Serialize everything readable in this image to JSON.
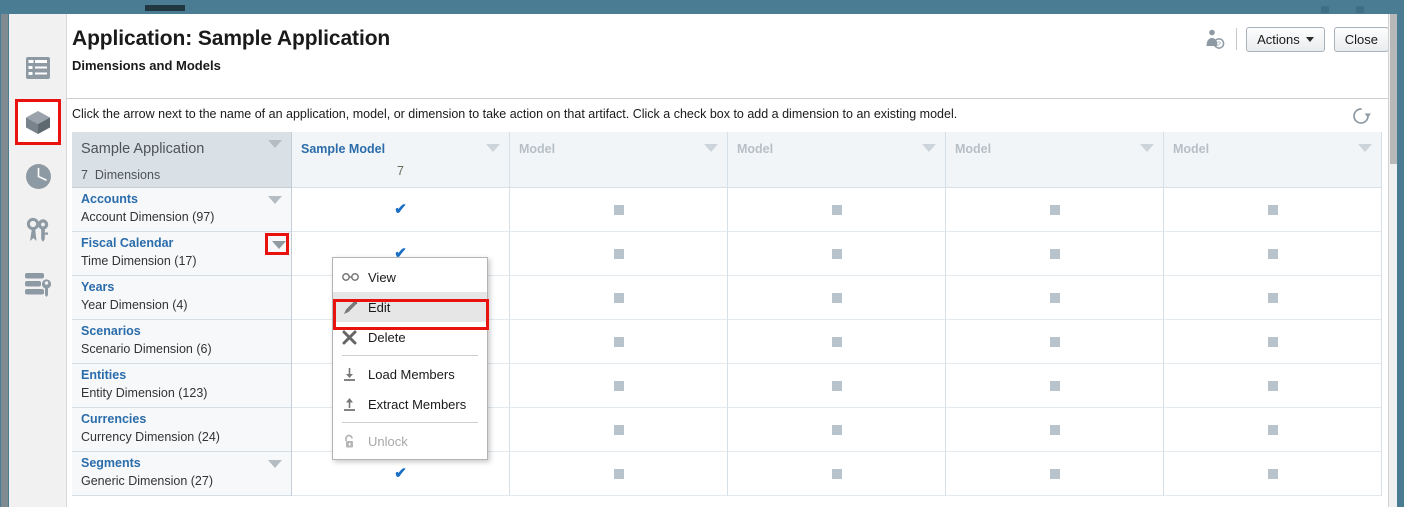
{
  "window": {
    "accent_teal": "#4a7d94",
    "highlight_red": "#e8130f",
    "link_blue": "#2b6cab"
  },
  "rail": {
    "items": [
      {
        "icon": "list-library-icon",
        "label": "Library",
        "selected": false
      },
      {
        "icon": "cube-icon",
        "label": "Dimensions and Models",
        "selected": true
      },
      {
        "icon": "clock-icon",
        "label": "Jobs",
        "selected": false
      },
      {
        "icon": "wrench-key-icon",
        "label": "Access Control",
        "selected": false
      },
      {
        "icon": "database-key-icon",
        "label": "Data Access",
        "selected": false
      }
    ]
  },
  "header": {
    "title": "Application: Sample Application",
    "subtitle": "Dimensions and Models",
    "person_icon": "user-badge-icon",
    "actions_label": "Actions",
    "close_label": "Close",
    "instruction": "Click the arrow next to the name of an application, model, or dimension to take action on that artifact. Click a check box to add a dimension to an existing model.",
    "refresh_icon": "refresh-icon"
  },
  "grid": {
    "application": {
      "name": "Sample Application",
      "dimension_count": "7",
      "dimension_count_label": "Dimensions",
      "caret_icon": "chevron-down-icon"
    },
    "model_columns": [
      {
        "name": "Sample Model",
        "count": "7",
        "placeholder": false
      },
      {
        "name": "Model",
        "count": "",
        "placeholder": true
      },
      {
        "name": "Model",
        "count": "",
        "placeholder": true
      },
      {
        "name": "Model",
        "count": "",
        "placeholder": true
      },
      {
        "name": "Model",
        "count": "",
        "placeholder": true
      }
    ],
    "rows": [
      {
        "name": "Accounts",
        "type": "Account Dimension  (97)",
        "caret": true,
        "caret_highlighted": false,
        "cells": [
          "check",
          "square",
          "square",
          "square",
          "square"
        ]
      },
      {
        "name": "Fiscal Calendar",
        "type": "Time Dimension  (17)",
        "caret": true,
        "caret_highlighted": true,
        "cells": [
          "check",
          "square",
          "square",
          "square",
          "square"
        ]
      },
      {
        "name": "Years",
        "type": "Year Dimension  (4)",
        "caret": false,
        "caret_highlighted": false,
        "cells": [
          "check",
          "square",
          "square",
          "square",
          "square"
        ]
      },
      {
        "name": "Scenarios",
        "type": "Scenario Dimension  (6)",
        "caret": false,
        "caret_highlighted": false,
        "cells": [
          "check",
          "square",
          "square",
          "square",
          "square"
        ]
      },
      {
        "name": "Entities",
        "type": "Entity Dimension  (123)",
        "caret": false,
        "caret_highlighted": false,
        "cells": [
          "check",
          "square",
          "square",
          "square",
          "square"
        ]
      },
      {
        "name": "Currencies",
        "type": "Currency Dimension  (24)",
        "caret": false,
        "caret_highlighted": false,
        "cells": [
          "check",
          "square",
          "square",
          "square",
          "square"
        ]
      },
      {
        "name": "Segments",
        "type": "Generic Dimension  (27)",
        "caret": true,
        "caret_highlighted": false,
        "cells": [
          "check",
          "square",
          "square",
          "square",
          "square"
        ]
      }
    ]
  },
  "context_menu": {
    "items": [
      {
        "label": "View",
        "icon": "glasses-icon",
        "disabled": false,
        "selected": false,
        "separator_before": false
      },
      {
        "label": "Edit",
        "icon": "pencil-icon",
        "disabled": false,
        "selected": true,
        "separator_before": false
      },
      {
        "label": "Delete",
        "icon": "x-delete-icon",
        "disabled": false,
        "selected": false,
        "separator_before": false
      },
      {
        "label": "Load Members",
        "icon": "download-icon",
        "disabled": false,
        "selected": false,
        "separator_before": true
      },
      {
        "label": "Extract Members",
        "icon": "upload-icon",
        "disabled": false,
        "selected": false,
        "separator_before": false
      },
      {
        "label": "Unlock",
        "icon": "padlock-open-icon",
        "disabled": true,
        "selected": false,
        "separator_before": true
      }
    ]
  }
}
